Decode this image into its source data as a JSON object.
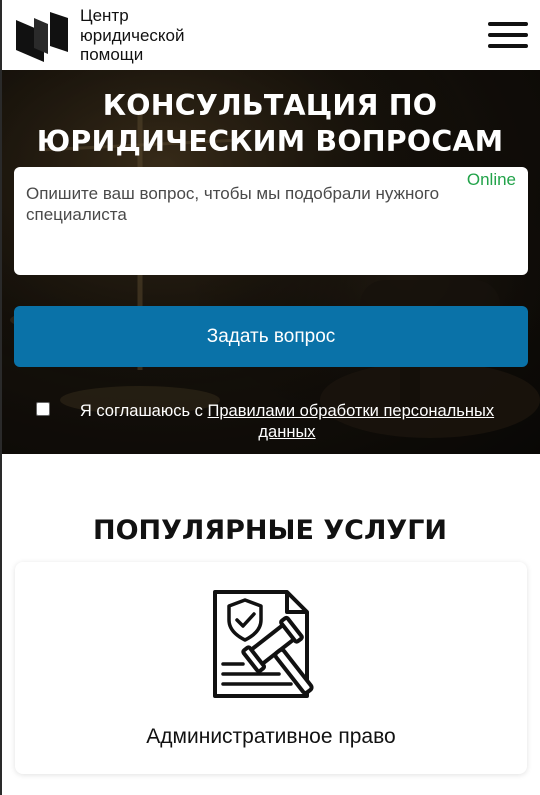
{
  "header": {
    "logo_lines": [
      "Центр",
      "юридической",
      "помощи"
    ],
    "menu_icon": "hamburger-menu-icon"
  },
  "hero": {
    "title_lines": [
      "КОНСУЛЬТАЦИЯ ПО",
      "ЮРИДИЧЕСКИМ ВОПРОСАМ"
    ],
    "question_placeholder": "Опишите ваш вопрос, чтобы мы подобрали нужного специалиста",
    "online_label": "Online",
    "ask_button": "Задать вопрос",
    "consent_prefix": "Я соглашаюсь с ",
    "consent_link": "Правилами обработки персональных данных"
  },
  "services": {
    "title": "ПОПУЛЯРНЫЕ УСЛУГИ",
    "items": [
      {
        "label": "Административное право",
        "icon": "legal-document-gavel-icon"
      }
    ]
  },
  "colors": {
    "accent_button": "#0a72a8",
    "online_green": "#22a34a",
    "text_dark": "#111111"
  }
}
